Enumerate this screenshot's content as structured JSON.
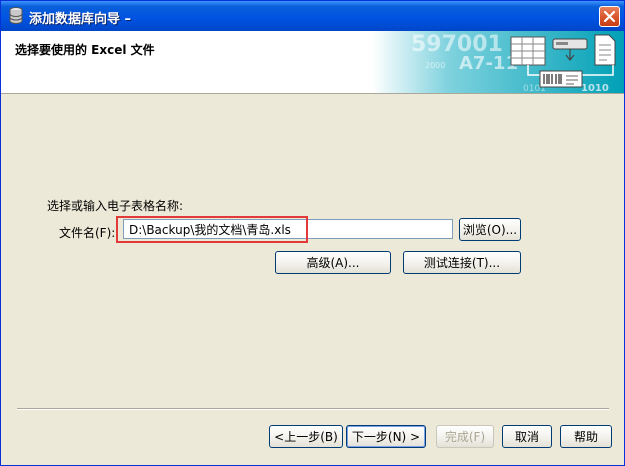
{
  "window": {
    "title": "添加数据库向导 –",
    "close_icon": "close-icon"
  },
  "header": {
    "title": "选择要使用的 Excel 文件",
    "art": {
      "text_1": "597001",
      "text_2": "A7-11",
      "text_3": "1010",
      "text_4": "0101",
      "text_5": "2000"
    }
  },
  "form": {
    "prompt": "选择或输入电子表格名称:",
    "file_label": "文件名(F):",
    "file_value": "D:\\Backup\\我的文档\\青岛.xls",
    "browse_label": "浏览(O)...",
    "advanced_label": "高级(A)...",
    "test_label": "测试连接(T)..."
  },
  "nav": {
    "back_label": "<上一步(B)",
    "next_label": "下一步(N) >",
    "finish_label": "完成(F)",
    "cancel_label": "取消",
    "help_label": "帮助"
  },
  "colors": {
    "titlebar": "#0054e3",
    "dialog_bg": "#ece9d8",
    "highlight": "#e23a3a",
    "art_teal": "#00a3b8"
  }
}
